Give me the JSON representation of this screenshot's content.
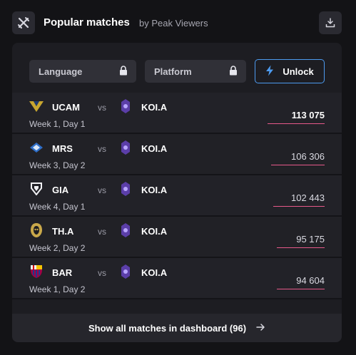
{
  "header": {
    "title": "Popular matches",
    "subtitle": "by Peak Viewers"
  },
  "filters": {
    "language_label": "Language",
    "platform_label": "Platform",
    "unlock_label": "Unlock"
  },
  "matches": [
    {
      "team": "UCAM",
      "vs": "vs",
      "opponent": "KOI.A",
      "week": "Week 1, Day 1",
      "peak_viewers": "113 075",
      "bar_fraction": 1.0
    },
    {
      "team": "MRS",
      "vs": "vs",
      "opponent": "KOI.A",
      "week": "Week 3, Day 2",
      "peak_viewers": "106 306",
      "bar_fraction": 0.94
    },
    {
      "team": "GIA",
      "vs": "vs",
      "opponent": "KOI.A",
      "week": "Week 4, Day 1",
      "peak_viewers": "102 443",
      "bar_fraction": 0.906
    },
    {
      "team": "TH.A",
      "vs": "vs",
      "opponent": "KOI.A",
      "week": "Week 2, Day 2",
      "peak_viewers": "95 175",
      "bar_fraction": 0.842
    },
    {
      "team": "BAR",
      "vs": "vs",
      "opponent": "KOI.A",
      "week": "Week 1, Day 2",
      "peak_viewers": "94 604",
      "bar_fraction": 0.837
    }
  ],
  "footer": {
    "label": "Show all matches in dashboard (96)"
  },
  "colors": {
    "accent_blue": "#4d9bf0",
    "bar_pink": "#e7598a"
  }
}
